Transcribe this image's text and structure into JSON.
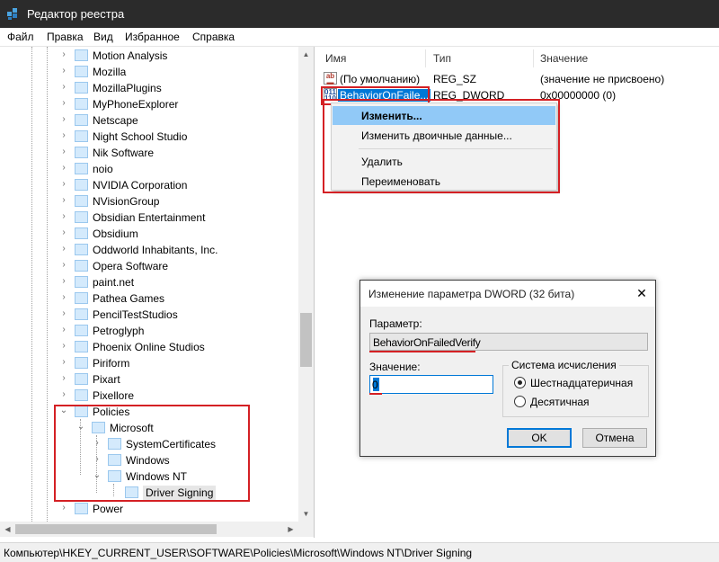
{
  "window": {
    "title": "Редактор реестра",
    "icon": "regedit-icon"
  },
  "menu": [
    "Файл",
    "Правка",
    "Вид",
    "Избранное",
    "Справка"
  ],
  "tree": {
    "items": [
      {
        "label": "Motion Analysis",
        "expander": "collapsed"
      },
      {
        "label": "Mozilla",
        "expander": "collapsed"
      },
      {
        "label": "MozillaPlugins",
        "expander": "collapsed"
      },
      {
        "label": "MyPhoneExplorer",
        "expander": "collapsed"
      },
      {
        "label": "Netscape",
        "expander": "collapsed"
      },
      {
        "label": "Night School Studio",
        "expander": "collapsed"
      },
      {
        "label": "Nik Software",
        "expander": "collapsed"
      },
      {
        "label": "noio",
        "expander": "collapsed"
      },
      {
        "label": "NVIDIA Corporation",
        "expander": "collapsed"
      },
      {
        "label": "NVisionGroup",
        "expander": "collapsed"
      },
      {
        "label": "Obsidian Entertainment",
        "expander": "collapsed"
      },
      {
        "label": "Obsidium",
        "expander": "collapsed"
      },
      {
        "label": "Oddworld Inhabitants, Inc.",
        "expander": "collapsed"
      },
      {
        "label": "Opera Software",
        "expander": "collapsed"
      },
      {
        "label": "paint.net",
        "expander": "collapsed"
      },
      {
        "label": "Pathea Games",
        "expander": "collapsed"
      },
      {
        "label": "PencilTestStudios",
        "expander": "collapsed"
      },
      {
        "label": "Petroglyph",
        "expander": "collapsed"
      },
      {
        "label": "Phoenix Online Studios",
        "expander": "collapsed"
      },
      {
        "label": "Piriform",
        "expander": "collapsed"
      },
      {
        "label": "Pixart",
        "expander": "collapsed"
      },
      {
        "label": "Pixellore",
        "expander": "collapsed"
      },
      {
        "label": "Policies",
        "expander": "expanded"
      },
      {
        "label": "Microsoft",
        "expander": "expanded"
      },
      {
        "label": "SystemCertificates",
        "expander": "collapsed"
      },
      {
        "label": "Windows",
        "expander": "collapsed"
      },
      {
        "label": "Windows NT",
        "expander": "expanded"
      },
      {
        "label": "Driver Signing",
        "expander": "none",
        "selected": true
      },
      {
        "label": "Power",
        "expander": "collapsed"
      }
    ]
  },
  "values": {
    "columns": [
      "Имя",
      "Тип",
      "Значение"
    ],
    "rows": [
      {
        "name": "(По умолчанию)",
        "type": "REG_SZ",
        "data": "(значение не присвоено)",
        "icon": "string-value-icon"
      },
      {
        "name": "BehaviorOnFaile...",
        "type": "REG_DWORD",
        "data": "0x00000000 (0)",
        "icon": "binary-value-icon",
        "selected": true
      }
    ]
  },
  "context_menu": {
    "items": [
      "Изменить...",
      "Изменить двоичные данные...",
      "Удалить",
      "Переименовать"
    ],
    "highlighted": "Изменить..."
  },
  "dialog": {
    "title": "Изменение параметра DWORD (32 бита)",
    "param_label": "Параметр:",
    "param_value": "BehaviorOnFailedVerify",
    "value_label": "Значение:",
    "value": "0",
    "radix_group": "Система исчисления",
    "radix_options": [
      "Шестнадцатеричная",
      "Десятичная"
    ],
    "radix_selected": "Шестнадцатеричная",
    "ok": "OK",
    "cancel": "Отмена",
    "close_icon": "close-icon"
  },
  "status": {
    "path": "Компьютер\\HKEY_CURRENT_USER\\SOFTWARE\\Policies\\Microsoft\\Windows NT\\Driver Signing"
  },
  "colors": {
    "highlight": "#0078d7",
    "annotation_red": "#d42024",
    "menu_highlight": "#91c9f7"
  }
}
